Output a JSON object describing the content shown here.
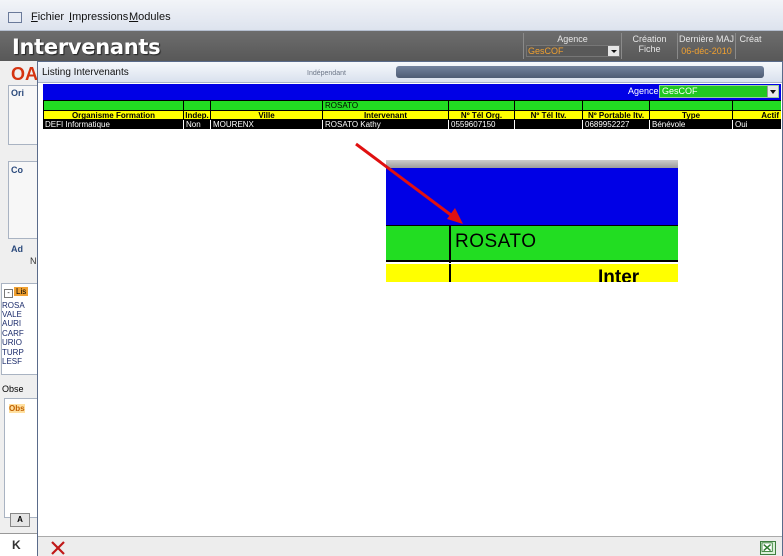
{
  "menubar": {
    "items": [
      "Fichier",
      "Impressions",
      "Modules"
    ]
  },
  "header": {
    "title": "Intervenants",
    "agence_label": "Agence",
    "agence_value": "GesCOF",
    "creation_label": "Création Fiche",
    "creation_value": "",
    "maj_label": "Dernière MAJ",
    "maj_value": "06-déc-2010",
    "creat_label": "Créat",
    "creat_value": ""
  },
  "background_form": {
    "logo": "OA",
    "label_ori": "Ori",
    "label_co": "Co",
    "label_ad": "Ad",
    "label_n": "N",
    "list_header": "Lis",
    "list_items": [
      "ROSA",
      "VALE",
      "AURI",
      "CARF",
      "URIO",
      "TURP",
      "LESF"
    ],
    "tab_obs": "Obse",
    "obs_label": "Obs",
    "a_button": "A",
    "first_button": "K"
  },
  "popup": {
    "title": "Listing Intervenants",
    "ghost_label": "Indépendant",
    "agence_label": "Agence :",
    "agence_value": "GesCOF"
  },
  "grid": {
    "filter_row": [
      "",
      "",
      "",
      "ROSATO",
      "",
      "",
      "",
      "",
      ""
    ],
    "columns": [
      "Organisme Formation",
      "Indep.",
      "Ville",
      "Intervenant",
      "Nº Tél Org.",
      "Nº Tél Itv.",
      "Nº Portable Itv.",
      "Type",
      "Actif"
    ],
    "rows": [
      [
        "DEFI Informatique",
        "Non",
        "MOURENX",
        "ROSATO Kathy",
        "0559607150",
        "",
        "0689952227",
        "Bénévole",
        "Oui"
      ]
    ]
  },
  "zoom_inset": {
    "filter_text": "ROSATO",
    "header_fragment": "Inter"
  },
  "colors": {
    "blue_band": "#0000e6",
    "filter_green": "#22dd22",
    "header_yellow": "#ffff00",
    "arrow_red": "#e01010"
  },
  "icons": {
    "close": "close-x-icon",
    "export": "excel-export-icon",
    "first_record": "first-record-icon"
  }
}
